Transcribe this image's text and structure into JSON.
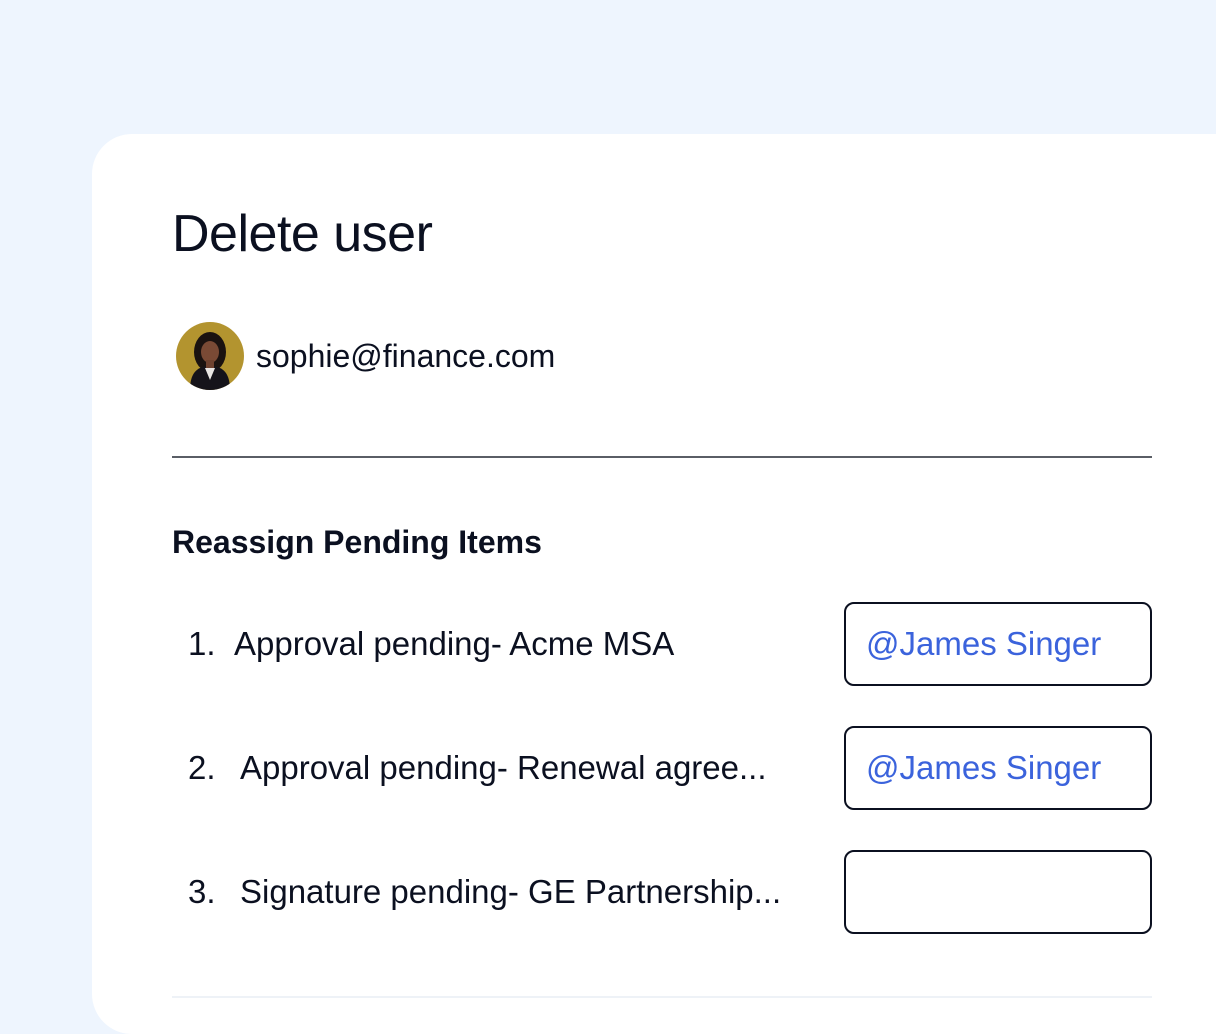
{
  "dialog": {
    "title": "Delete user"
  },
  "user": {
    "email": "sophie@finance.com",
    "avatar_icon": "user-avatar-photo"
  },
  "section": {
    "title": "Reassign Pending Items"
  },
  "items": [
    {
      "number": "1.",
      "label": "Approval pending- Acme MSA",
      "assignee": "@James Singer"
    },
    {
      "number": "2.",
      "label": "Approval pending- Renewal agree...",
      "assignee": "@James Singer"
    },
    {
      "number": "3.",
      "label": "Signature pending- GE Partnership...",
      "assignee": ""
    }
  ],
  "colors": {
    "background": "#eef5fe",
    "card": "#ffffff",
    "text": "#0b1020",
    "mention": "#3b63dc",
    "avatar_bg": "#b3942f"
  }
}
